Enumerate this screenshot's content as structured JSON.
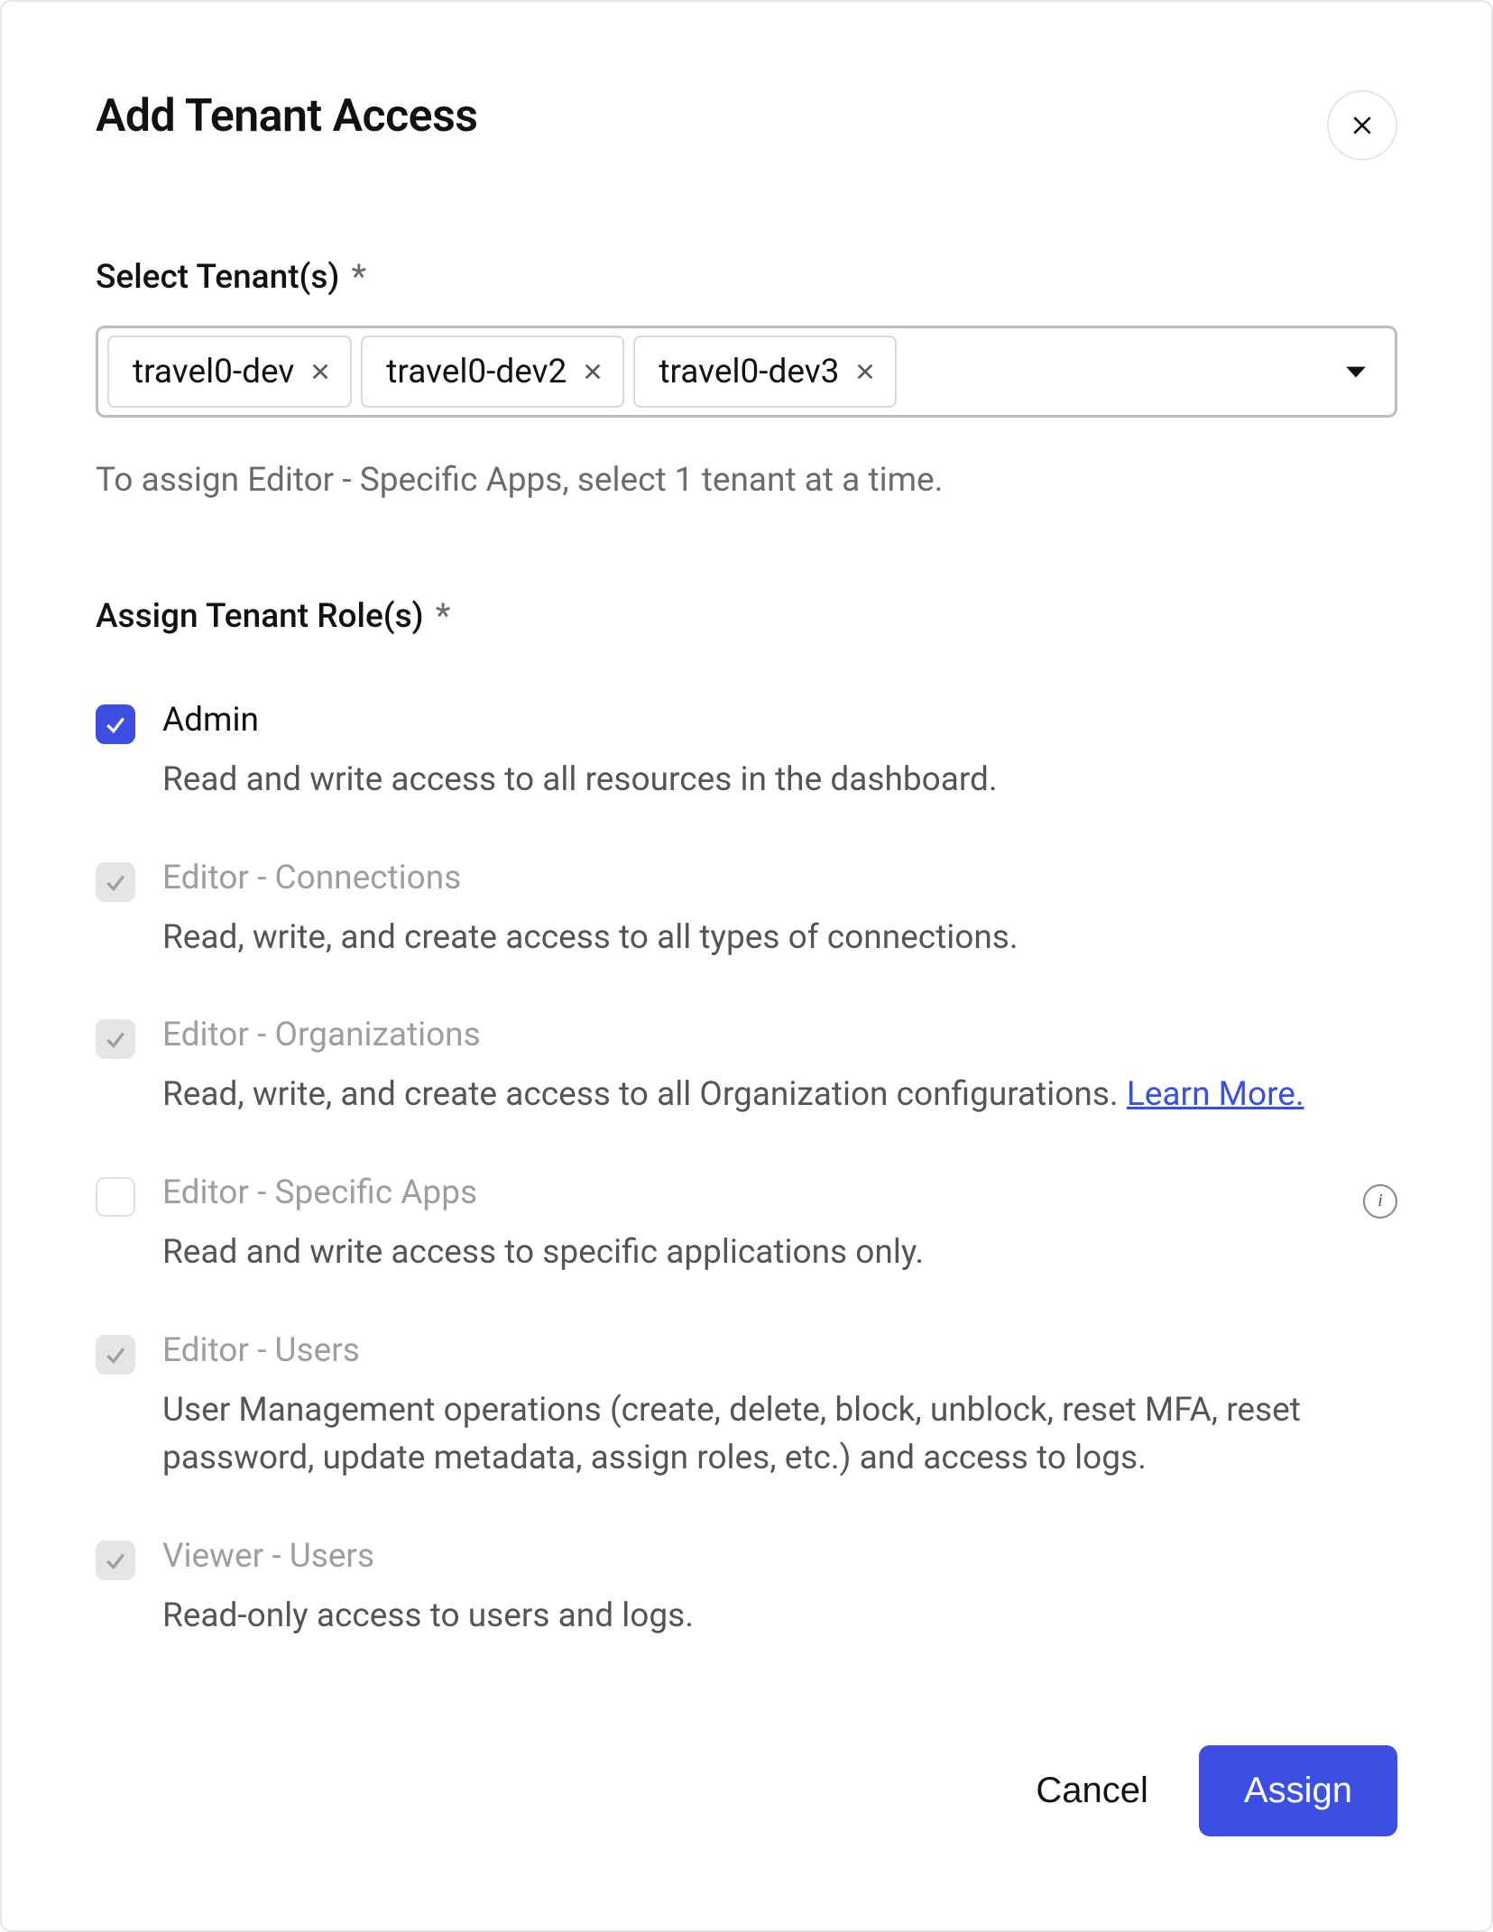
{
  "dialog": {
    "title": "Add Tenant Access",
    "select_label": "Select Tenant(s)",
    "required_mark": "*",
    "chips": [
      {
        "label": "travel0-dev"
      },
      {
        "label": "travel0-dev2"
      },
      {
        "label": "travel0-dev3"
      }
    ],
    "helper": "To assign Editor - Specific Apps, select 1 tenant at a time.",
    "roles_label": "Assign Tenant Role(s)",
    "roles": [
      {
        "name": "Admin",
        "desc": "Read and write access to all resources in the dashboard.",
        "state": "checked"
      },
      {
        "name": "Editor - Connections",
        "desc": "Read, write, and create access to all types of connections.",
        "state": "disabled-checked"
      },
      {
        "name": "Editor - Organizations",
        "desc": "Read, write, and create access to all Organization configurations.",
        "link": "Learn More.",
        "state": "disabled-checked"
      },
      {
        "name": "Editor - Specific Apps",
        "desc": "Read and write access to specific applications only.",
        "state": "disabled-empty",
        "info": true
      },
      {
        "name": "Editor - Users",
        "desc": "User Management operations (create, delete, block, unblock, reset MFA, reset password, update metadata, assign roles, etc.) and access to logs.",
        "state": "disabled-checked"
      },
      {
        "name": "Viewer - Users",
        "desc": "Read-only access to users and logs.",
        "state": "disabled-checked"
      }
    ],
    "cancel": "Cancel",
    "assign": "Assign"
  }
}
